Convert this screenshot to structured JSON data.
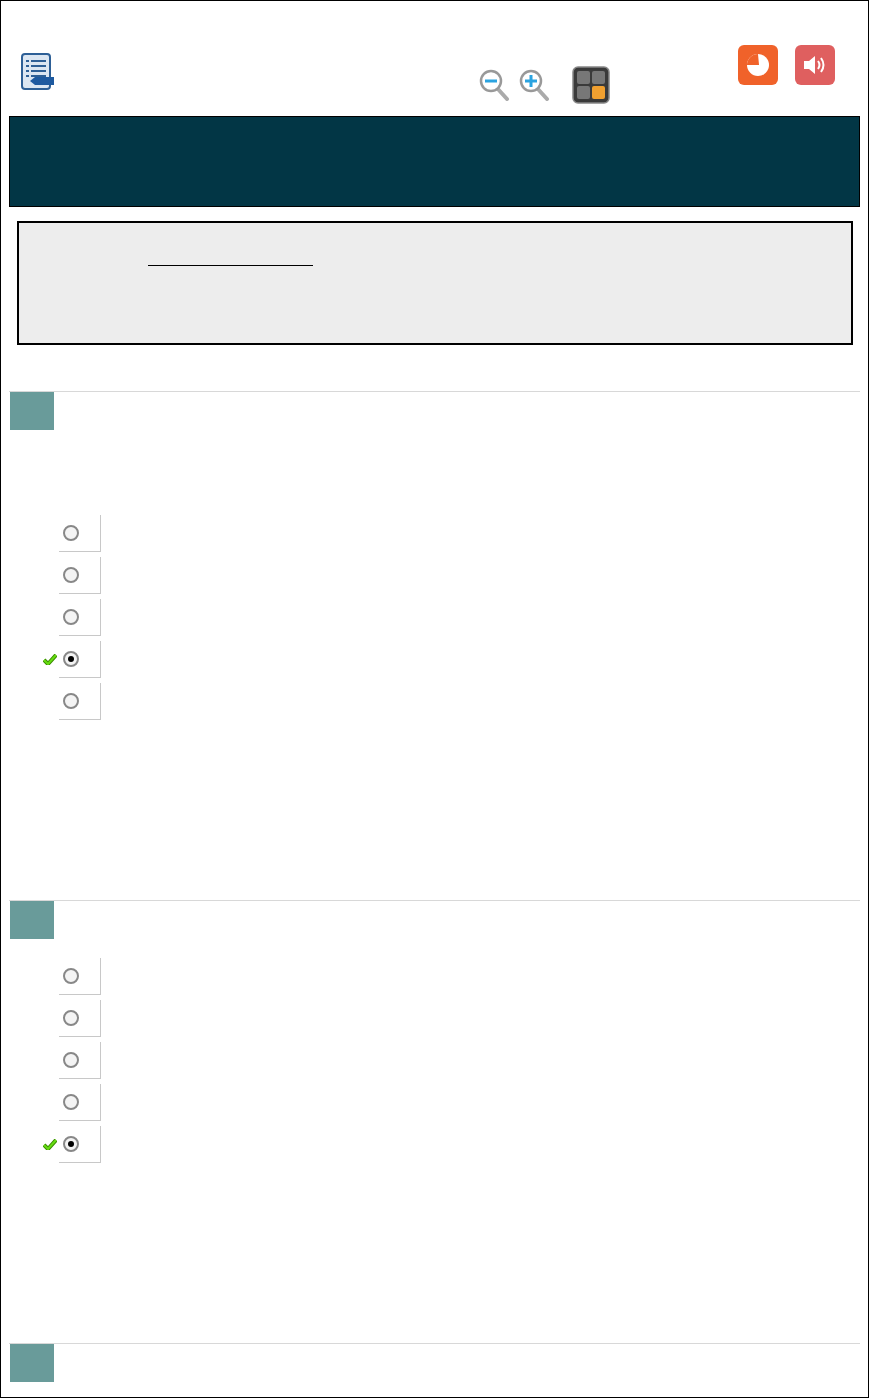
{
  "questions": [
    {
      "kind": "question",
      "options": [
        {
          "selected": false,
          "checkmark": false
        },
        {
          "selected": false,
          "checkmark": false
        },
        {
          "selected": false,
          "checkmark": false
        },
        {
          "selected": true,
          "checkmark": true
        },
        {
          "selected": false,
          "checkmark": false
        }
      ]
    },
    {
      "kind": "question",
      "options": [
        {
          "selected": false,
          "checkmark": false
        },
        {
          "selected": false,
          "checkmark": false
        },
        {
          "selected": false,
          "checkmark": false
        },
        {
          "selected": false,
          "checkmark": false
        },
        {
          "selected": true,
          "checkmark": true
        }
      ]
    },
    {
      "kind": "question"
    }
  ]
}
